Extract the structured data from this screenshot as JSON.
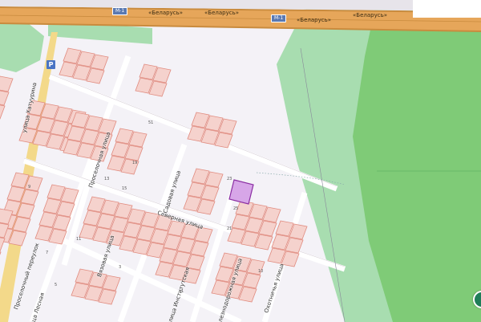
{
  "map": {
    "colors": {
      "background": "#f4f2f7",
      "highway": "#e6a65a",
      "highway_casing": "#c98b3e",
      "forest": "#7fcb77",
      "meadow": "#a8ddb0",
      "parcel_fill": "#f5d2cd",
      "parcel_stroke": "#e08b7f",
      "selected_parcel": "#d7a6e8",
      "selected_stroke": "#8b2fa3"
    },
    "highway": {
      "shield": "M-1",
      "labels": [
        "«Беларусь»",
        "«Беларусь»",
        "«Беларусь»",
        "«Беларусь»"
      ]
    },
    "streets": {
      "hatuyrina": "улица Хатуурина",
      "proselochnaya": "Проселочная улица",
      "severnaya": "Северная улица",
      "sadovaya": "Садовая улица",
      "vyaznaya": "Вязовая улица",
      "proselochny_per": "Проселочный переулок",
      "lesnaya": "улица Лесная",
      "institutskaya": "улица Институтская",
      "ohotnichya": "Охотничья улица",
      "zheleznodorozhnaya": "Железнодорожная улица"
    },
    "poi": {
      "icon": "parking-icon",
      "label": "P"
    },
    "lot_numbers": [
      "23",
      "25",
      "21",
      "51",
      "19",
      "15",
      "11",
      "9",
      "13",
      "7",
      "5",
      "3",
      "1",
      "10"
    ]
  }
}
